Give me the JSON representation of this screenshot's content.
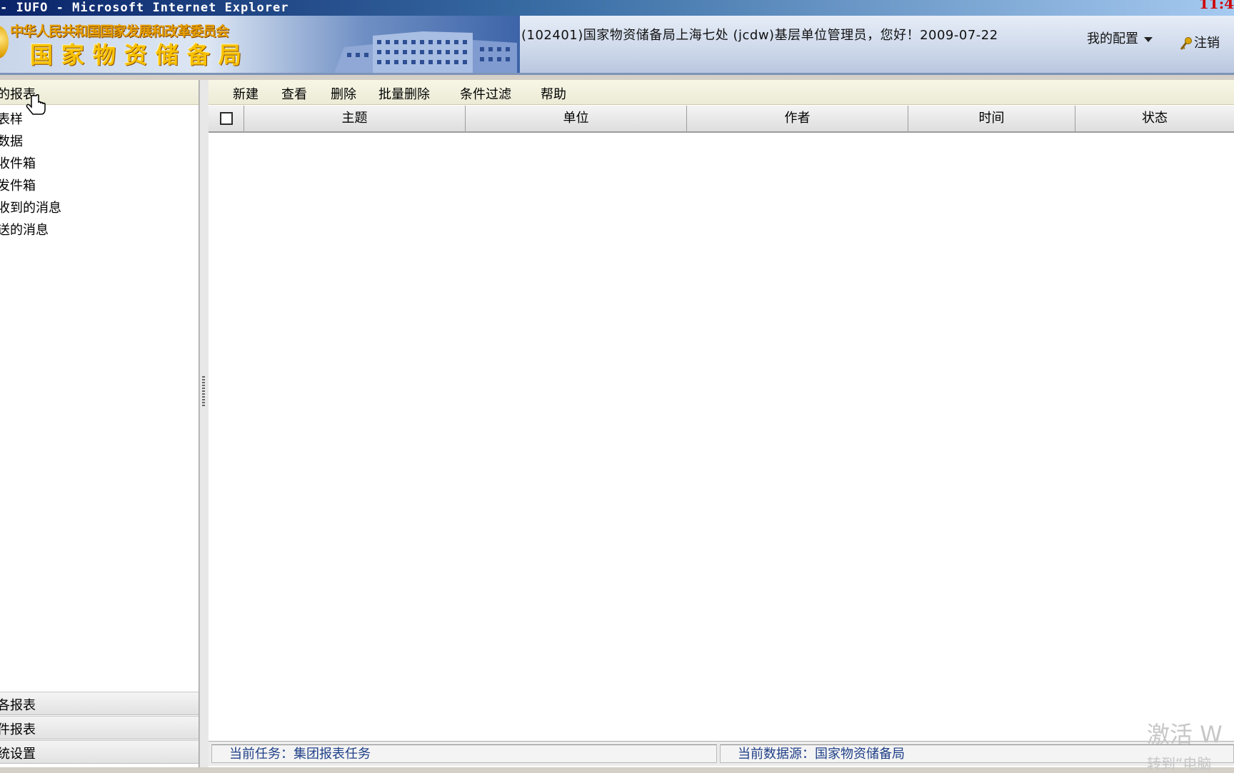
{
  "window": {
    "title": "- IUFO - Microsoft Internet Explorer",
    "clock": "11:4"
  },
  "header": {
    "org_line1": "中华人民共和国国家发展和改革委员会",
    "org_line2": "国家物资储备局",
    "welcome": "(102401)国家物资储备局上海七处 (jcdw)基层单位管理员，您好！2009-07-22",
    "my_config": "我的配置",
    "logout": "注销"
  },
  "nav": {
    "header": "的报表",
    "items": [
      "表样",
      "数据",
      "收件箱",
      "发件箱",
      "收到的消息",
      "送的消息"
    ],
    "bottom": [
      "各报表",
      "件报表",
      "统设置"
    ]
  },
  "toolbar": {
    "new": "新建",
    "view": "查看",
    "delete": "删除",
    "batch_delete": "批量删除",
    "filter": "条件过滤",
    "help": "帮助"
  },
  "table": {
    "columns": [
      "主题",
      "单位",
      "作者",
      "时间",
      "状态"
    ],
    "rows": []
  },
  "status": {
    "task": "当前任务：集团报表任务",
    "datasource": "当前数据源：国家物资储备局"
  },
  "watermark": {
    "line1": "激活 W",
    "line2": "转到“电脑"
  }
}
